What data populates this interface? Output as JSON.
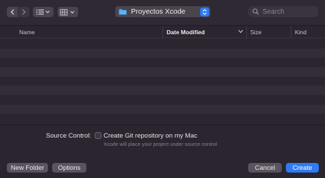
{
  "toolbar": {
    "back_icon": "chevron-left-icon",
    "forward_icon": "chevron-right-icon",
    "list_view_icon": "list-view-icon",
    "grid_view_icon": "grid-view-icon",
    "folder_name": "Proyectos Xcode",
    "folder_icon": "folder-icon",
    "search_placeholder": "Search"
  },
  "columns": {
    "name": "Name",
    "date_modified": "Date Modified",
    "size": "Size",
    "kind": "Kind"
  },
  "file_rows": 9,
  "source_control": {
    "label": "Source Control:",
    "checkbox_label": "Create Git repository on my Mac",
    "checked": false,
    "hint": "Xcode will place your project under source control"
  },
  "buttons": {
    "new_folder": "New Folder",
    "options": "Options",
    "cancel": "Cancel",
    "create": "Create"
  },
  "colors": {
    "accent": "#2d7cf5",
    "background": "#2b2530",
    "row_alt": "#332d38"
  }
}
